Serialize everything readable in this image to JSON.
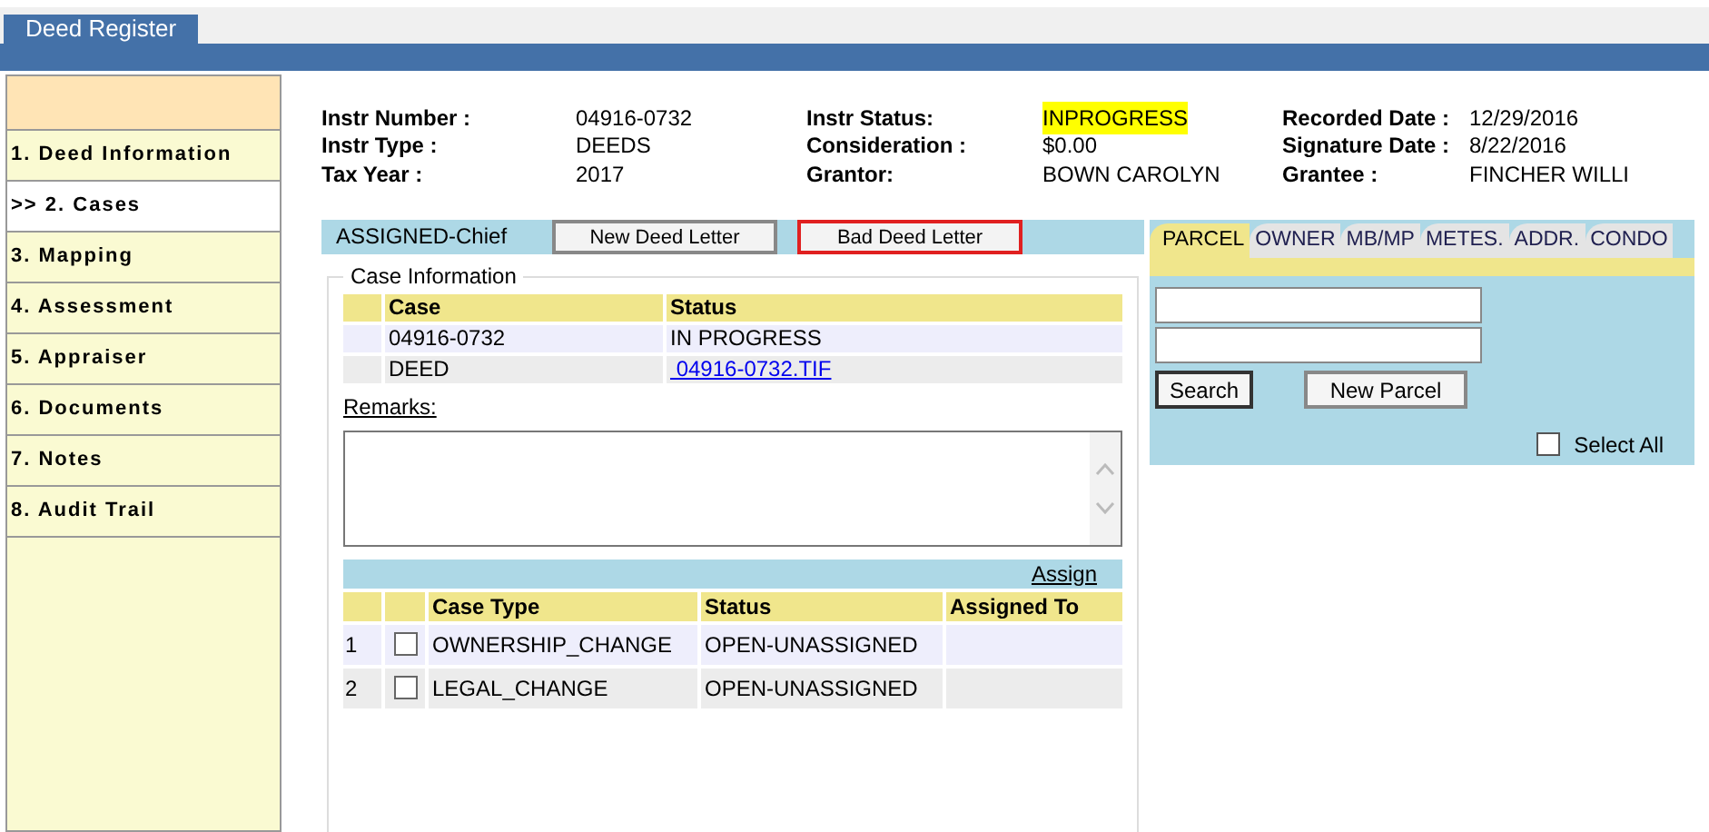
{
  "window": {
    "title": "Deed Register"
  },
  "sidebar": {
    "items": [
      {
        "label": "1. Deed Information",
        "selected": false
      },
      {
        "label": ">> 2. Cases",
        "selected": true
      },
      {
        "label": "3. Mapping",
        "selected": false
      },
      {
        "label": "4. Assessment",
        "selected": false
      },
      {
        "label": "5. Appraiser",
        "selected": false
      },
      {
        "label": "6. Documents",
        "selected": false
      },
      {
        "label": "7. Notes",
        "selected": false
      },
      {
        "label": "8. Audit Trail",
        "selected": false
      }
    ]
  },
  "header": {
    "rows": [
      [
        {
          "label": "Instr Number :",
          "value": "04916-0732"
        },
        {
          "label": "Instr Status:",
          "value": "INPROGRESS",
          "highlighted": true
        },
        {
          "label": "Recorded Date :",
          "value": "12/29/2016"
        }
      ],
      [
        {
          "label": "Instr Type :",
          "value": "DEEDS"
        },
        {
          "label": "Consideration :",
          "value": "$0.00",
          "highlighted": false
        },
        {
          "label": "Signature Date :",
          "value": "8/22/2016"
        }
      ],
      [
        {
          "label": "Tax Year :",
          "value": "2017"
        },
        {
          "label": "Grantor:",
          "value": "BOWN CAROLYN",
          "highlighted": false
        },
        {
          "label": "Grantee :",
          "value": "FINCHER WILLI"
        }
      ]
    ]
  },
  "toolbar": {
    "assignment": "ASSIGNED-Chief",
    "buttons": [
      {
        "label": "New Deed Letter",
        "outlined": false
      },
      {
        "label": "Bad Deed Letter",
        "outlined": true
      }
    ]
  },
  "case_information": {
    "title": "Case Information",
    "columns": [
      "Case",
      "Status"
    ],
    "rows": [
      {
        "case": "04916-0732",
        "status": "IN PROGRESS",
        "kind": "text"
      },
      {
        "case": "DEED",
        "status": " 04916-0732.TIF",
        "kind": "link"
      }
    ],
    "remarks_label": "Remarks:"
  },
  "cases": {
    "assign_link": "Assign",
    "columns": [
      "Case Type",
      "Status",
      "Assigned To"
    ],
    "rows": [
      {
        "number": "1",
        "checked": false,
        "case_type": "OWNERSHIP_CHANGE",
        "status": "OPEN-UNASSIGNED"
      },
      {
        "number": "2",
        "checked": false,
        "case_type": "LEGAL_CHANGE",
        "status": "OPEN-UNASSIGNED"
      }
    ]
  },
  "search_panel": {
    "tabs": [
      {
        "label": "PARCEL",
        "selected": true
      },
      {
        "label": "OWNER",
        "selected": false
      },
      {
        "label": "MB/MP",
        "selected": false
      },
      {
        "label": "METES.",
        "selected": false
      },
      {
        "label": "ADDR.",
        "selected": false
      },
      {
        "label": "CONDO",
        "selected": false
      }
    ],
    "search_button": "Search",
    "new_parcel_button": "New Parcel",
    "select_all": {
      "label": "Select All",
      "checked": false
    }
  }
}
